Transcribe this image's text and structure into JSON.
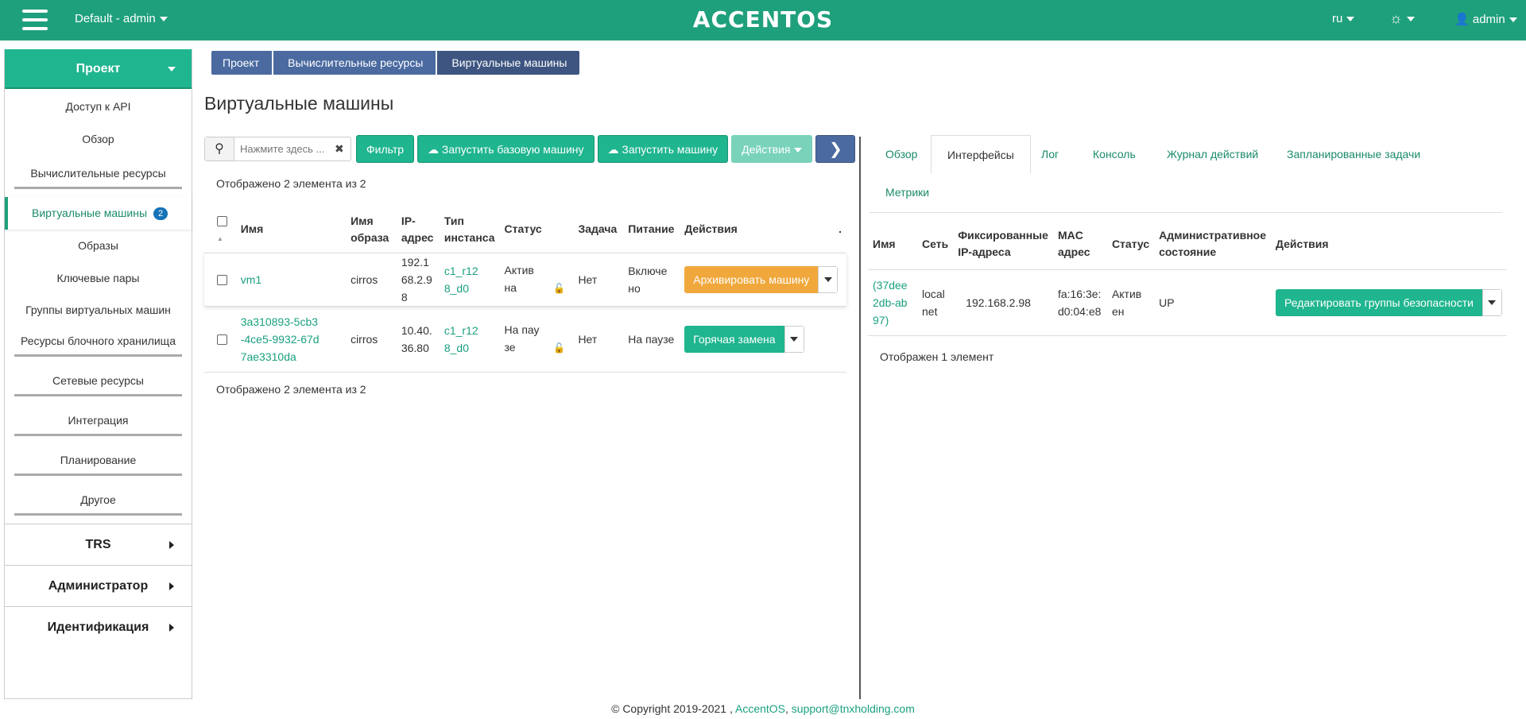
{
  "topbar": {
    "project_switcher": "Default - admin",
    "brand": "ACCENTOS",
    "lang": "ru",
    "user": "admin"
  },
  "sidebar": {
    "header": "Проект",
    "items": [
      "Доступ к API",
      "Обзор"
    ],
    "group_compute": "Вычислительные ресурсы",
    "active_item": "Виртуальные машины",
    "active_badge": "2",
    "compute_items": [
      "Образы",
      "Ключевые пары",
      "Группы виртуальных машин"
    ],
    "groups": [
      "Ресурсы блочного хранилища",
      "Сетевые ресурсы",
      "Интеграция",
      "Планирование",
      "Другое"
    ],
    "sections": [
      "TRS",
      "Администратор",
      "Идентификация"
    ]
  },
  "breadcrumb": [
    "Проект",
    "Вычислительные ресурсы",
    "Виртуальные машины"
  ],
  "page_title": "Виртуальные машины",
  "toolbar": {
    "search_placeholder": "Нажмите здесь ...",
    "filter": "Фильтр",
    "launch_basic": "Запустить базовую машину",
    "launch": "Запустить машину",
    "actions": "Действия"
  },
  "vm_count_text": "Отображено 2 элемента из 2",
  "vm_table": {
    "headers": [
      "Имя",
      "Имя образа",
      "IP-адрес",
      "Тип инстанса",
      "Статус",
      "Задача",
      "Питание",
      "Действия",
      "."
    ],
    "rows": [
      {
        "name": "vm1",
        "image": "cirros",
        "ip": "192.168.2.98",
        "flavor": "c1_r128_d0",
        "status": "Активна",
        "task": "Нет",
        "power": "Включено",
        "action": "Архивировать машину",
        "action_color": "#f0a83c"
      },
      {
        "name": "3a310893-5cb3-4ce5-9932-67d7ae3310da",
        "image": "cirros",
        "ip": "10.40.36.80",
        "flavor": "c1_r128_d0",
        "status": "На паузе",
        "task": "Нет",
        "power": "На паузе",
        "action": "Горячая замена",
        "action_color": "#1fb58f"
      }
    ]
  },
  "detail_tabs": [
    "Обзор",
    "Интерфейсы",
    "Лог",
    "Консоль",
    "Журнал действий",
    "Запланированные задачи",
    "Метрики"
  ],
  "if_table": {
    "headers": [
      "Имя",
      "Сеть",
      "Фиксированные IP-адреса",
      "MAC адрес",
      "Статус",
      "Административное состояние",
      "Действия"
    ],
    "rows": [
      {
        "name": "(37dee2db-ab97)",
        "network": "local net",
        "ip": "192.168.2.98",
        "mac": "fa:16:3e:d0:04:e8",
        "status": "Активен",
        "admin_state": "UP",
        "action": "Редактировать группы безопасности"
      }
    ]
  },
  "if_count_text": "Отображен 1 элемент",
  "footer": {
    "copyright": "© Copyright 2019-2021 ,",
    "link1": "AccentOS",
    "sep": ",",
    "link2": "support@tnxholding.com"
  }
}
